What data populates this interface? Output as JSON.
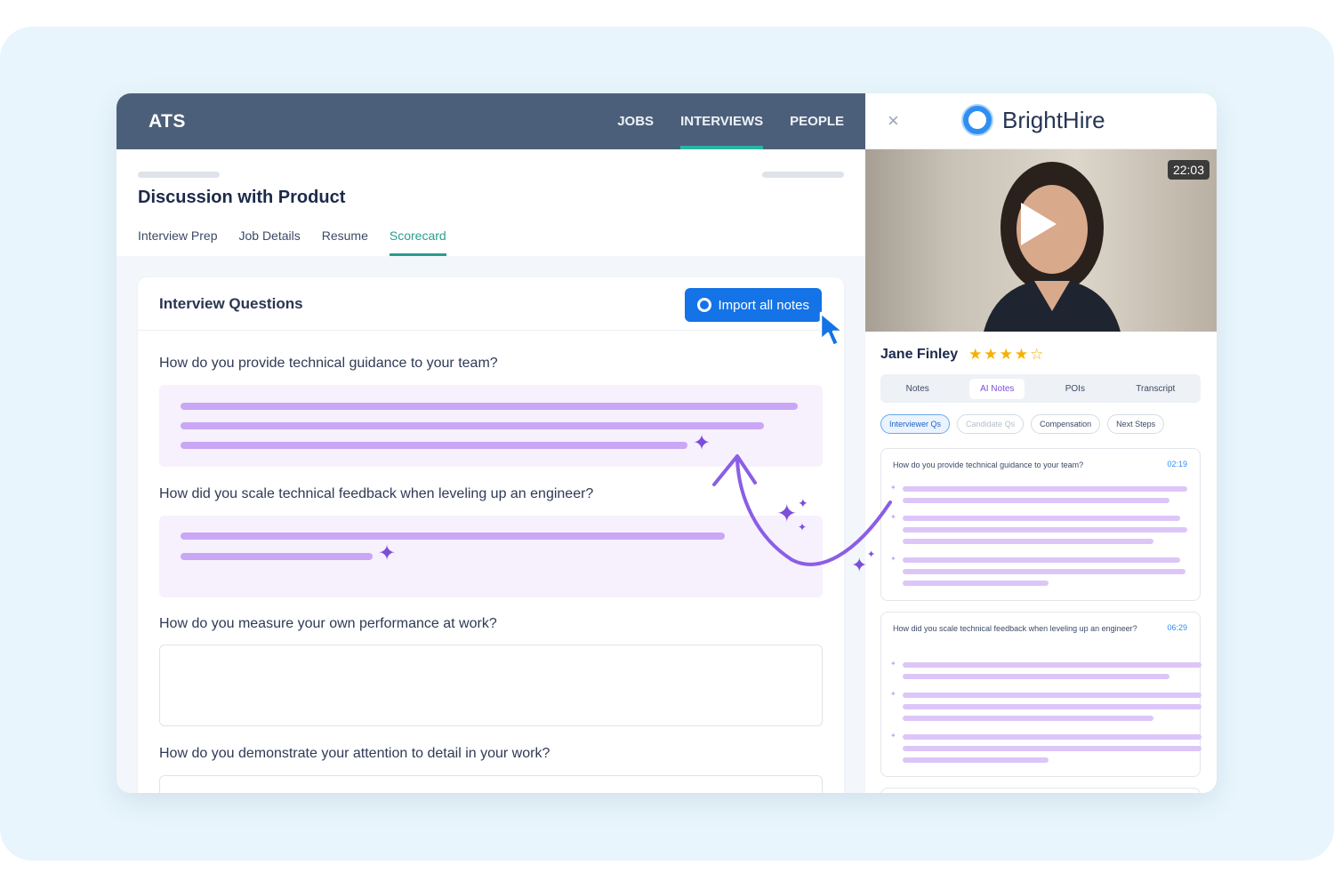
{
  "ats": {
    "logo": "ATS",
    "nav": [
      "JOBS",
      "INTERVIEWS",
      "PEOPLE"
    ],
    "active_nav": "INTERVIEWS",
    "page_title": "Discussion with Product",
    "tabs": [
      "Interview Prep",
      "Job Details",
      "Resume",
      "Scorecard"
    ],
    "active_tab": "Scorecard",
    "section_title": "Interview Questions",
    "import_button": "Import all notes",
    "questions": [
      "How do you provide technical guidance to your team?",
      "How did you scale technical feedback when leveling up an engineer?",
      "How do you measure your own performance at work?",
      "How do you demonstrate your attention to detail in your work?"
    ]
  },
  "brighthire": {
    "close": "×",
    "brand": "BrightHire",
    "video_time": "22:03",
    "candidate_name": "Jane Finley",
    "rating": 4,
    "rating_max": 5,
    "segments": [
      "Notes",
      "AI Notes",
      "POIs",
      "Transcript"
    ],
    "active_segment": "AI Notes",
    "chips": [
      "Interviewer Qs",
      "Candidate Qs",
      "Compensation",
      "Next Steps"
    ],
    "active_chip": "Interviewer Qs",
    "note_cards": [
      {
        "question": "How do you provide technical guidance to your team?",
        "time": "02:19"
      },
      {
        "question": "How did you scale technical feedback when leveling up an engineer?",
        "time": "06:29"
      }
    ]
  },
  "colors": {
    "header_bg": "#4c5f7a",
    "accent_teal": "#2a9d8f",
    "button_blue": "#1473e6",
    "ai_purple": "#7b4fd9",
    "brand_blue": "#2f8ff0"
  },
  "icons": {
    "close": "close-icon",
    "play": "play-icon",
    "sparkle": "sparkle-icon",
    "cursor": "pointer-cursor-icon",
    "logo": "brighthire-logo-icon"
  }
}
